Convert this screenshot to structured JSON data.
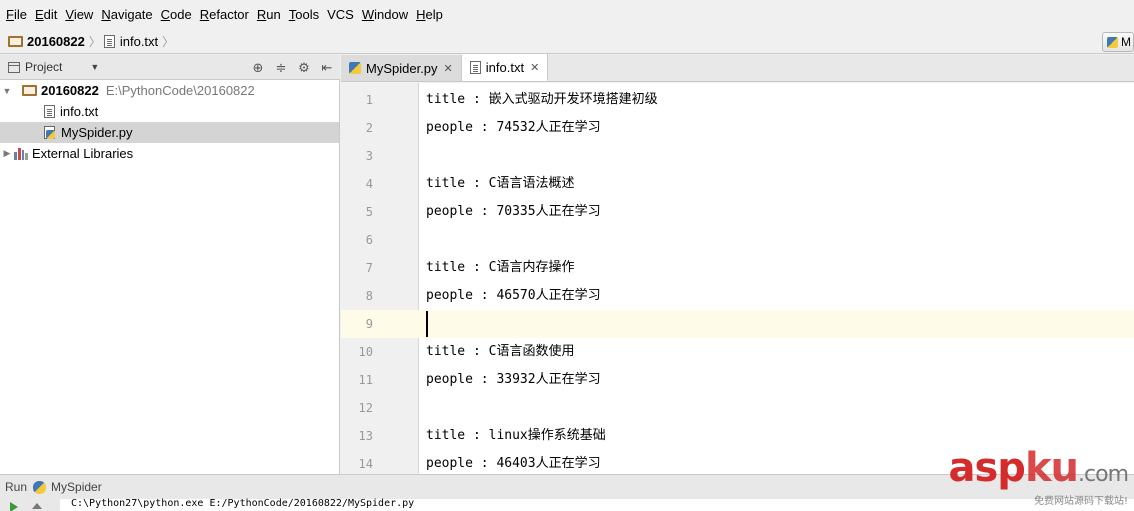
{
  "menu": [
    {
      "mnemonic": "F",
      "rest": "ile"
    },
    {
      "mnemonic": "E",
      "rest": "dit"
    },
    {
      "mnemonic": "V",
      "rest": "iew"
    },
    {
      "mnemonic": "N",
      "rest": "avigate"
    },
    {
      "mnemonic": "C",
      "rest": "ode"
    },
    {
      "mnemonic": "R",
      "rest": "efactor"
    },
    {
      "mnemonic": "R",
      "rest": "un",
      "pre": "",
      "label": "Run"
    },
    {
      "mnemonic": "T",
      "rest": "ools"
    },
    {
      "mnemonic": "",
      "rest": "VCS"
    },
    {
      "mnemonic": "W",
      "rest": "indow"
    },
    {
      "mnemonic": "H",
      "rest": "elp"
    }
  ],
  "breadcrumb": {
    "project": "20160822",
    "file": "info.txt"
  },
  "run_config": {
    "label": "M"
  },
  "project_panel": {
    "title": "Project",
    "root_name": "20160822",
    "root_path": "E:\\PythonCode\\20160822",
    "files": [
      {
        "name": "info.txt",
        "type": "txt",
        "selected": false
      },
      {
        "name": "MySpider.py",
        "type": "py",
        "selected": true
      }
    ],
    "external": "External Libraries"
  },
  "tabs": [
    {
      "label": "MySpider.py",
      "type": "py",
      "active": false
    },
    {
      "label": "info.txt",
      "type": "txt",
      "active": true
    }
  ],
  "editor": {
    "current_line": 9,
    "lines": [
      {
        "num": "1",
        "text": "title : 嵌入式驱动开发环境搭建初级"
      },
      {
        "num": "2",
        "text": "people : 74532人正在学习"
      },
      {
        "num": "3",
        "text": ""
      },
      {
        "num": "4",
        "text": "title : C语言语法概述"
      },
      {
        "num": "5",
        "text": "people : 70335人正在学习"
      },
      {
        "num": "6",
        "text": ""
      },
      {
        "num": "7",
        "text": "title : C语言内存操作"
      },
      {
        "num": "8",
        "text": "people : 46570人正在学习"
      },
      {
        "num": "9",
        "text": ""
      },
      {
        "num": "10",
        "text": "title : C语言函数使用"
      },
      {
        "num": "11",
        "text": "people : 33932人正在学习"
      },
      {
        "num": "12",
        "text": ""
      },
      {
        "num": "13",
        "text": "title : linux操作系统基础"
      },
      {
        "num": "14",
        "text": "people : 46403人正在学习"
      }
    ]
  },
  "run_panel": {
    "label": "Run",
    "config": "MySpider",
    "console": "C:\\Python27\\python.exe E:/PythonCode/20160822/MySpider.py"
  },
  "watermark": {
    "main_a": "asp",
    "main_b": "ku",
    "main_c": ".com",
    "sub": "免费网站源码下载站!"
  },
  "colors": {
    "current_line": "#fefbe9",
    "selection": "#d4d4d4",
    "watermark": "#d42b2b"
  }
}
